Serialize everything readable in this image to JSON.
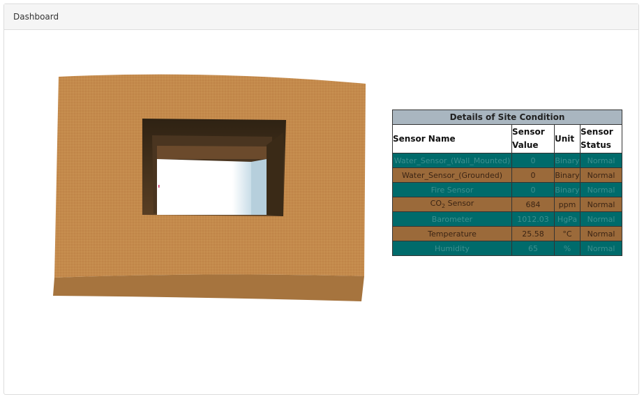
{
  "header": {
    "title": "Dashboard"
  },
  "table": {
    "caption": "Details of Site Condition",
    "columns": [
      "Sensor Name",
      "Sensor Value",
      "Unit",
      "Sensor Status"
    ],
    "rows": [
      {
        "name": "Water_Sensor_(Wall_Mounted)",
        "value": "0",
        "unit": "Binary",
        "status": "Normal",
        "color": "#006b6b"
      },
      {
        "name": "Water_Sensor_(Grounded)",
        "value": "0",
        "unit": "Binary",
        "status": "Normal",
        "color": "#9b6a3a"
      },
      {
        "name": "Fire Sensor",
        "value": "0",
        "unit": "Binary",
        "status": "Normal",
        "color": "#006b6b"
      },
      {
        "name": "CO",
        "name_sub": "2",
        "name_suffix": " Sensor",
        "value": "684",
        "unit": "ppm",
        "status": "Normal",
        "color": "#9b6a3a"
      },
      {
        "name": "Barometer",
        "value": "1012.03",
        "unit": "HgPa",
        "status": "Normal",
        "color": "#006b6b"
      },
      {
        "name": "Temperature",
        "value": "25.58",
        "unit": "°C",
        "status": "Normal",
        "color": "#9b6a3a"
      },
      {
        "name": "Humidity",
        "value": "65",
        "unit": "%",
        "status": "Normal",
        "color": "#006b6b"
      }
    ]
  },
  "colors": {
    "wall": "#c48a4c",
    "wall_edge": "#a6743e",
    "opening_dark": "#3a2a17",
    "window_light": "#ffffff",
    "header_bg": "#a9b6c0",
    "teal": "#006b6b",
    "brown": "#9b6a3a"
  }
}
